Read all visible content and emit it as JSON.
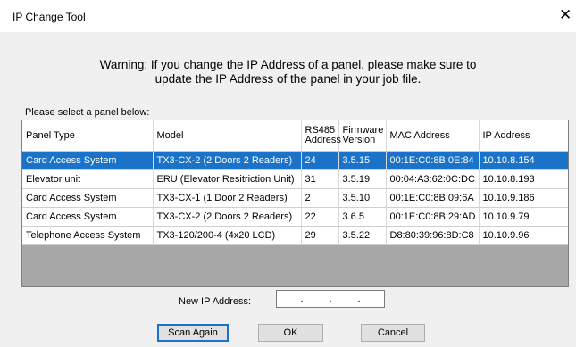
{
  "window": {
    "title": "IP Change Tool",
    "close_glyph": "✕"
  },
  "warning": {
    "line1": "Warning: If you change the IP Address of a panel, please make sure to",
    "line2": "update the IP Address of the panel in your job file."
  },
  "prompt": "Please select a panel below:",
  "table": {
    "headers": {
      "panel_type": "Panel Type",
      "model": "Model",
      "rs485": [
        "RS485",
        "Address"
      ],
      "firmware": [
        "Firmware",
        "Version"
      ],
      "mac": "MAC Address",
      "ip": "IP Address"
    },
    "rows": [
      {
        "panel_type": "Card Access System",
        "model": "TX3-CX-2 (2 Doors 2 Readers)",
        "rs485": "24",
        "firmware": "3.5.15",
        "mac": "00:1E:C0:8B:0E:84",
        "ip": "10.10.8.154",
        "selected": true
      },
      {
        "panel_type": "Elevator unit",
        "model": "ERU (Elevator Resitriction Unit)",
        "rs485": "31",
        "firmware": "3.5.19",
        "mac": "00:04:A3:62:0C:DC",
        "ip": "10.10.8.193",
        "selected": false
      },
      {
        "panel_type": "Card Access System",
        "model": "TX3-CX-1 (1 Door 2 Readers)",
        "rs485": "2",
        "firmware": "3.5.10",
        "mac": "00:1E:C0:8B:09:6A",
        "ip": "10.10.9.186",
        "selected": false
      },
      {
        "panel_type": "Card Access System",
        "model": "TX3-CX-2 (2 Doors 2 Readers)",
        "rs485": "22",
        "firmware": "3.6.5",
        "mac": "00:1E:C0:8B:29:AD",
        "ip": "10.10.9.79",
        "selected": false
      },
      {
        "panel_type": "Telephone Access System",
        "model": "TX3-120/200-4 (4x20 LCD)",
        "rs485": "29",
        "firmware": "3.5.22",
        "mac": "D8:80:39:96:8D:C8",
        "ip": "10.10.9.96",
        "selected": false
      }
    ]
  },
  "new_ip": {
    "label": "New IP Address:",
    "dots": [
      ".",
      ".",
      "."
    ]
  },
  "buttons": {
    "scan_again": "Scan Again",
    "ok": "OK",
    "cancel": "Cancel"
  },
  "colors": {
    "selection": "#1a73c8",
    "dialog_bg": "#f0f0f0",
    "empty_table_bg": "#a7a7a7"
  }
}
